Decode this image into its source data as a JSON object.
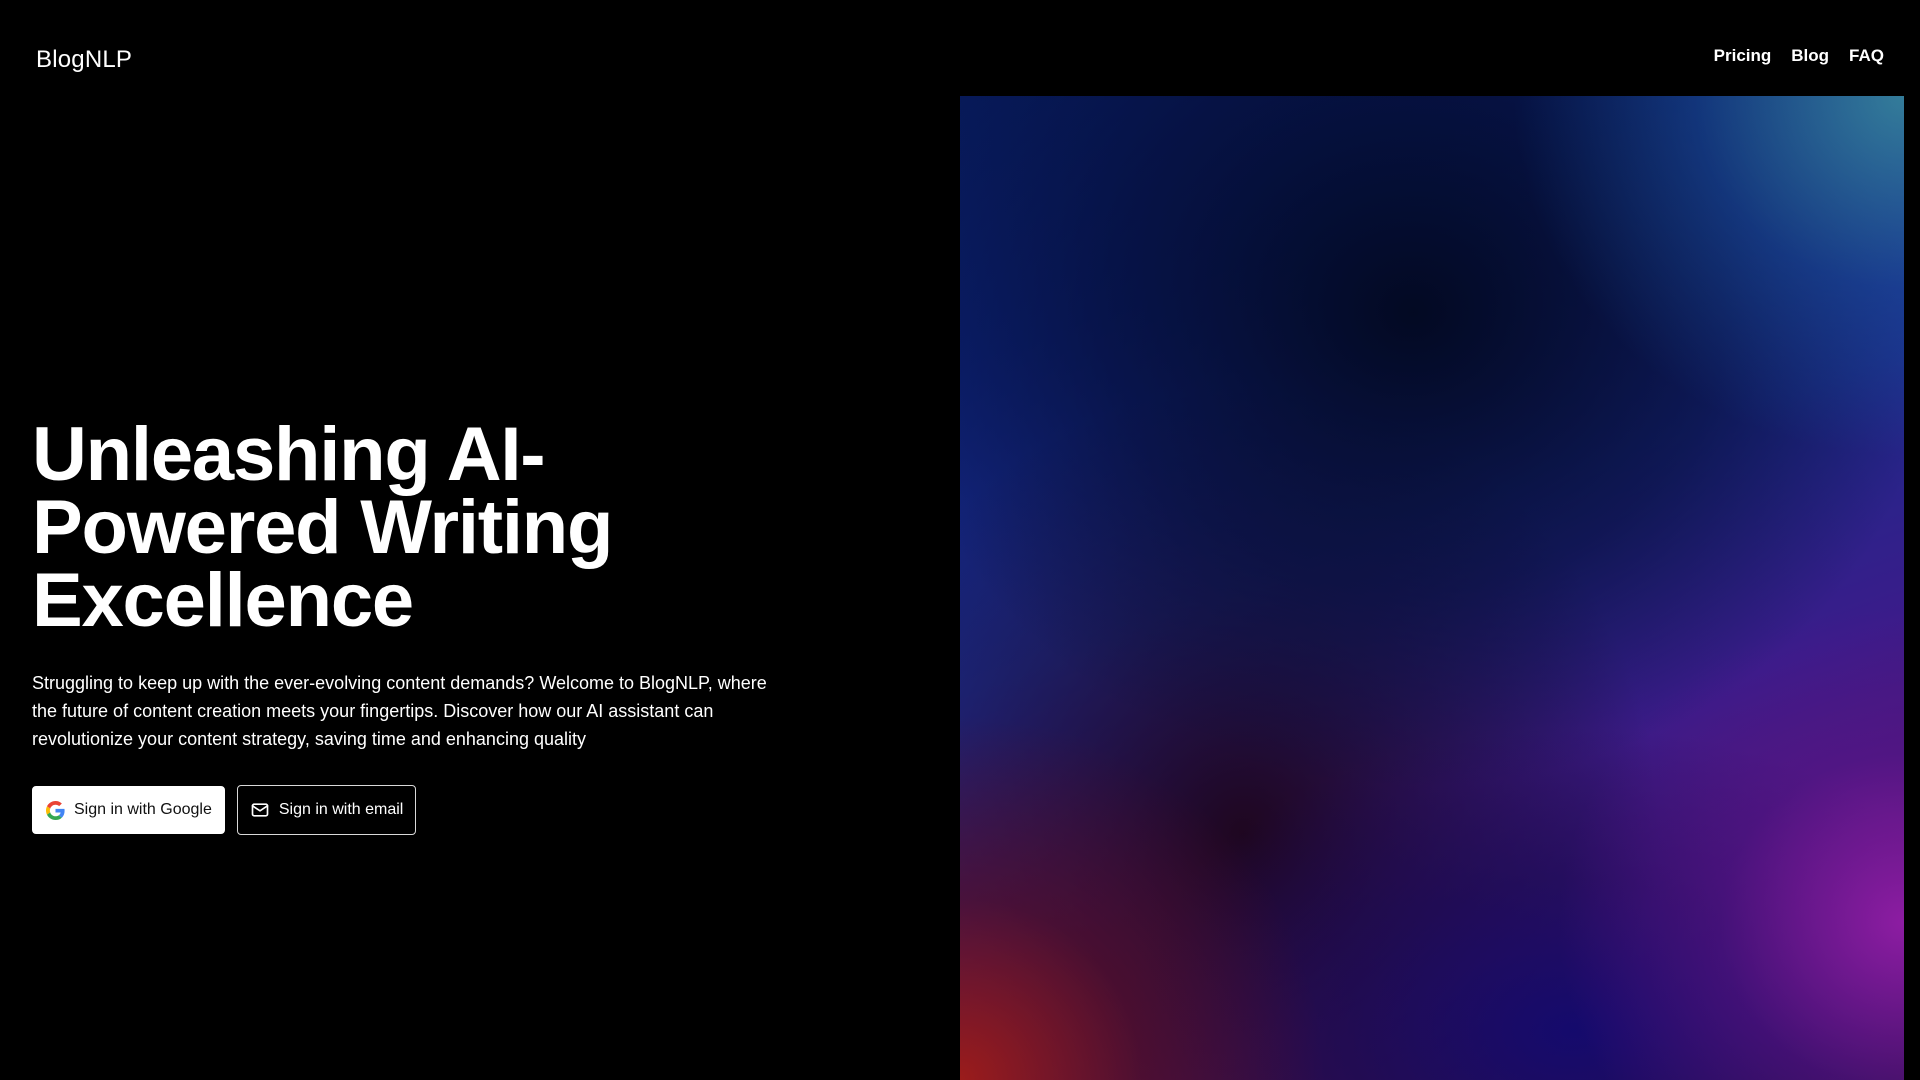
{
  "header": {
    "logo": "BlogNLP",
    "nav": [
      {
        "label": "Pricing"
      },
      {
        "label": "Blog"
      },
      {
        "label": "FAQ"
      }
    ]
  },
  "hero": {
    "headline_lines": [
      "Unleashing AI-",
      "Powered Writing",
      "Excellence"
    ],
    "subtext_lines": [
      "Struggling to keep up with the ever-evolving content demands? Welcome to BlogNLP, where",
      "the future of content creation meets your fingertips. Discover how our AI assistant can",
      "revolutionize your content strategy, saving time and enhancing quality"
    ],
    "buttons": {
      "google_label": "Sign in with Google",
      "google_icon": "google-icon",
      "email_label": "Sign in with email",
      "email_icon": "mail-icon"
    }
  },
  "colors": {
    "background": "#000000",
    "text": "#ffffff",
    "google_button_bg": "#ffffff",
    "email_button_border": "#d9d9d9"
  }
}
